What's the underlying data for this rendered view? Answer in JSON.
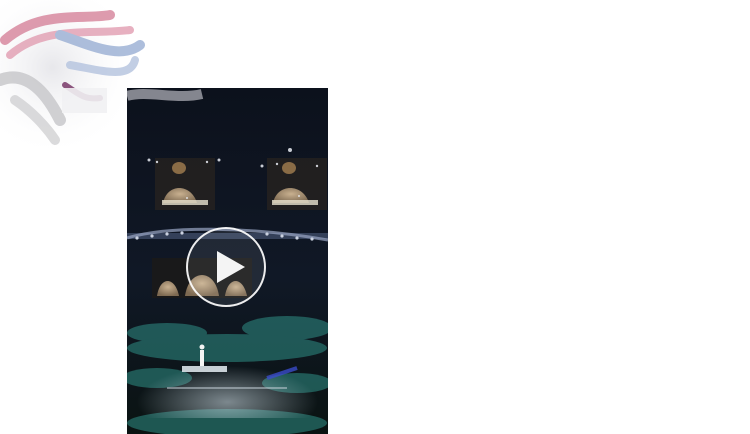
{
  "video": {
    "aria_label": "",
    "play_icon": "play-icon"
  },
  "colors": {
    "background": "#ffffff",
    "video_bg": "#0b0f18",
    "stage_teal": "#2f8f86",
    "scribble_pink": "#d88aa0",
    "scribble_blue": "#9fb3d6"
  }
}
